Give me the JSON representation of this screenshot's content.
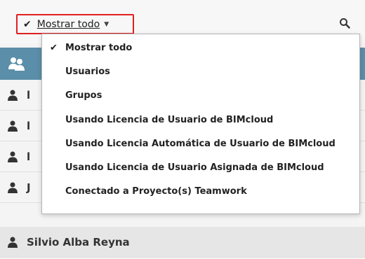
{
  "filter": {
    "check": "✔",
    "label": "Mostrar todo",
    "caret": "▼"
  },
  "toolbar": {
    "search_icon": "search-icon"
  },
  "header": {
    "icon": "group-icon"
  },
  "list": {
    "rows": [
      {
        "name": "l"
      },
      {
        "name": "l"
      },
      {
        "name": "l"
      },
      {
        "name": "J"
      },
      {
        "name": "Silvio Alba Reyna"
      }
    ]
  },
  "dropdown": {
    "checkmark": "✔",
    "items": [
      {
        "label": "Mostrar todo",
        "selected": true
      },
      {
        "label": "Usuarios",
        "selected": false
      },
      {
        "label": "Grupos",
        "selected": false
      },
      {
        "label": "Usando Licencia de Usuario de BIMcloud",
        "selected": false
      },
      {
        "label": "Usando Licencia Automática de Usuario de BIMcloud",
        "selected": false
      },
      {
        "label": "Usando Licencia de Usuario Asignada de BIMcloud",
        "selected": false
      },
      {
        "label": "Conectado a Proyecto(s) Teamwork",
        "selected": false
      }
    ]
  },
  "colors": {
    "header": "#5a8ea9",
    "highlight_border": "#e02020"
  }
}
